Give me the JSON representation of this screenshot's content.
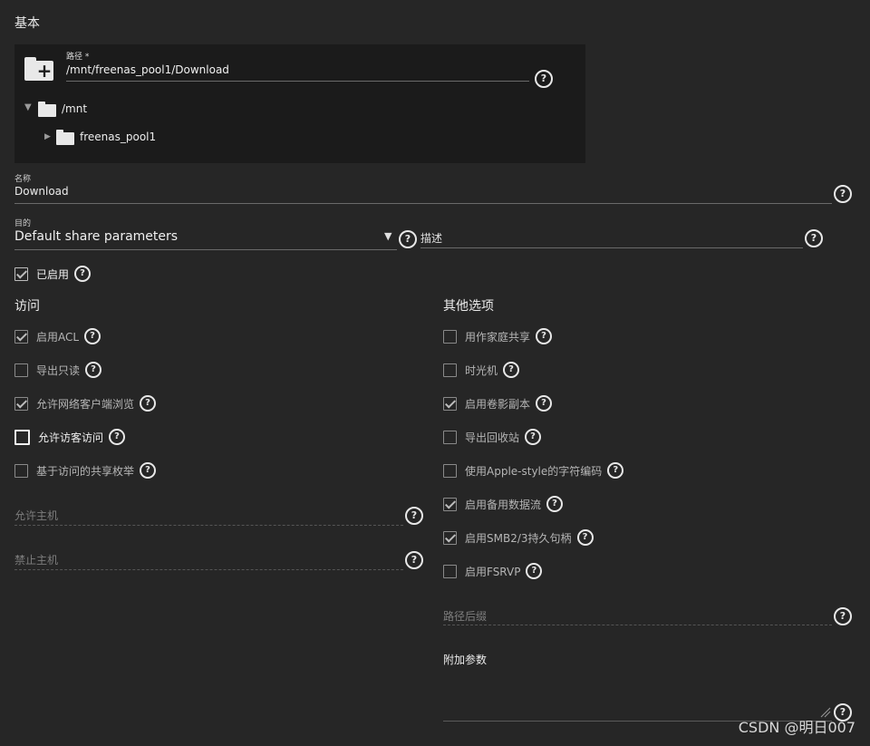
{
  "section_basic": {
    "title": "基本"
  },
  "path": {
    "label": "路径 *",
    "value": "/mnt/freenas_pool1/Download",
    "tree": {
      "root": "/mnt",
      "child": "freenas_pool1"
    },
    "add_icon": "folder-plus-icon"
  },
  "name": {
    "label": "名称",
    "value": "Download"
  },
  "purpose": {
    "label": "目的",
    "value": "Default share parameters"
  },
  "description": {
    "placeholder": "描述"
  },
  "enabled": {
    "label": "已启用",
    "checked": true
  },
  "access": {
    "title": "访问",
    "options": [
      {
        "label": "启用ACL",
        "checked": true
      },
      {
        "label": "导出只读",
        "checked": false
      },
      {
        "label": "允许网络客户端浏览",
        "checked": true
      },
      {
        "label": "允许访客访问",
        "checked": false
      },
      {
        "label": "基于访问的共享枚举",
        "checked": false
      }
    ],
    "hosts_allow": {
      "placeholder": "允许主机"
    },
    "hosts_deny": {
      "placeholder": "禁止主机"
    }
  },
  "other": {
    "title": "其他选项",
    "options": [
      {
        "label": "用作家庭共享",
        "checked": false
      },
      {
        "label": "时光机",
        "checked": false
      },
      {
        "label": "启用卷影副本",
        "checked": true
      },
      {
        "label": "导出回收站",
        "checked": false
      },
      {
        "label": "使用Apple-style的字符编码",
        "checked": false
      },
      {
        "label": "启用备用数据流",
        "checked": true
      },
      {
        "label": "启用SMB2/3持久句柄",
        "checked": true
      },
      {
        "label": "启用FSRVP",
        "checked": false
      }
    ],
    "path_suffix": {
      "placeholder": "路径后缀"
    },
    "aux_params": {
      "label": "附加参数",
      "value": ""
    }
  },
  "help_glyph": "?",
  "watermark": "CSDN @明日007"
}
